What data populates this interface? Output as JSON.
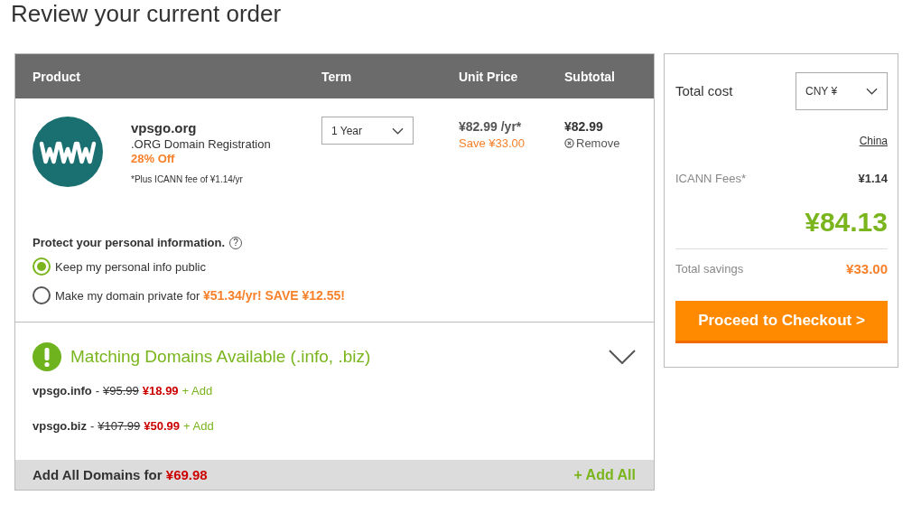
{
  "page_title": "Review your current order",
  "table": {
    "columns": [
      "Product",
      "Term",
      "Unit Price",
      "Subtotal"
    ],
    "item": {
      "domain": "vpsgo.org",
      "description": ".ORG Domain Registration",
      "discount": "28% Off",
      "fee_note": "*Plus ICANN fee of ¥1.14/yr",
      "term": "1 Year",
      "unit_price": "¥82.99 /yr*",
      "savings": "Save ¥33.00",
      "subtotal": "¥82.99",
      "remove": "Remove"
    }
  },
  "privacy": {
    "heading": "Protect your personal information.",
    "help": "?",
    "options": [
      {
        "label": "Keep my personal info public",
        "selected": true
      },
      {
        "label": "Make my domain private for **¥51.34/yr! SAVE ¥12.55!**",
        "selected": false
      }
    ]
  },
  "matching": {
    "title": "Matching Domains Available",
    "tlds": "(.info, .biz)",
    "expanded": true,
    "domains": [
      {
        "name": "vpsgo.info",
        "separator": "-",
        "old_price": "¥95.99",
        "price": "¥18.99",
        "action": "+ Add"
      },
      {
        "name": "vpsgo.biz",
        "separator": "-",
        "old_price": "¥107.99",
        "price": "¥50.99",
        "action": "+ Add"
      }
    ],
    "add_all_label": "Add All Domains for",
    "add_all_price": "¥69.98",
    "add_all_action": "+ Add All"
  },
  "summary": {
    "total_label": "Total cost",
    "currency": "CNY ¥",
    "country": "China",
    "fees_label": "ICANN Fees*",
    "fees": "¥1.14",
    "total": "¥84.13",
    "savings_label": "Total savings",
    "savings": "¥33.00",
    "checkout": "Proceed to Checkout >"
  }
}
